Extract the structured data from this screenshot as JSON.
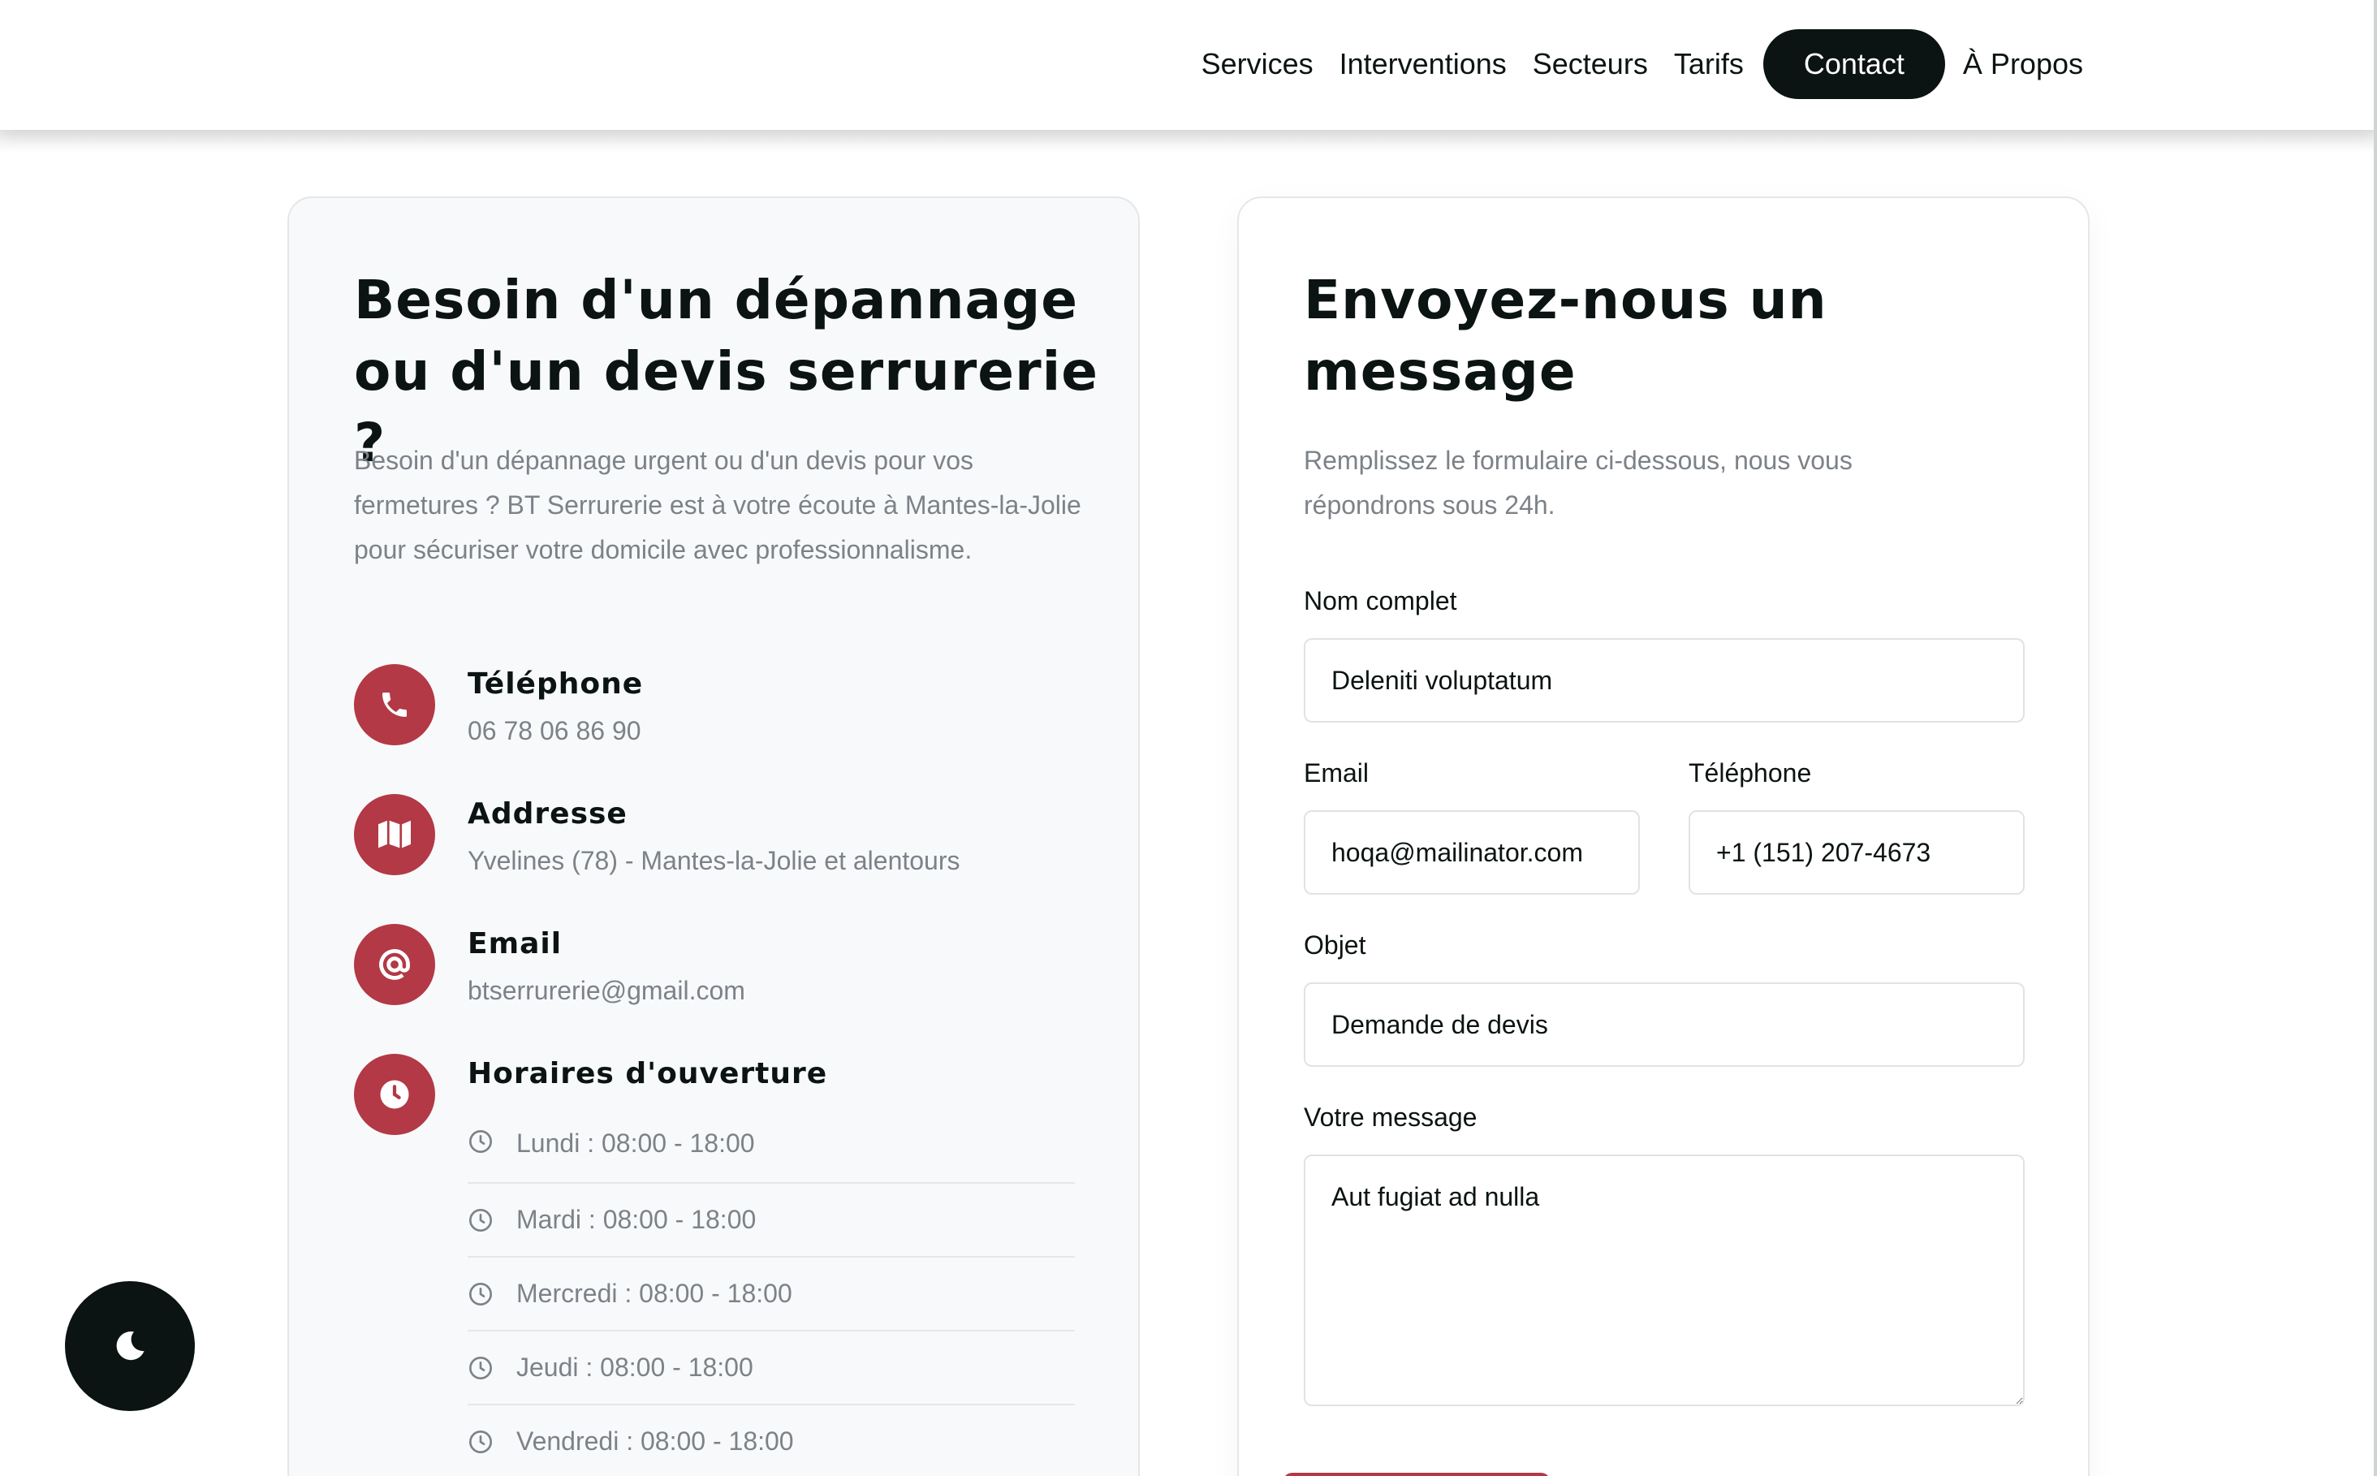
{
  "nav": {
    "items": [
      {
        "label": "Services"
      },
      {
        "label": "Interventions"
      },
      {
        "label": "Secteurs"
      },
      {
        "label": "Tarifs"
      },
      {
        "label": "Contact",
        "active": true
      },
      {
        "label": "À Propos"
      }
    ]
  },
  "contact_info": {
    "title": "Besoin d'un dépannage ou d'un devis serrurerie ?",
    "intro": "Besoin d'un dépannage urgent ou d'un devis pour vos fermetures ? BT Serrurerie est à votre écoute à Mantes-la-Jolie pour sécuriser votre domicile avec professionnalisme.",
    "phone": {
      "label": "Téléphone",
      "value": "06 78 06 86 90",
      "icon": "phone-icon"
    },
    "address": {
      "label": "Addresse",
      "value": "Yvelines (78) - Mantes-la-Jolie et alentours",
      "icon": "map-icon"
    },
    "email": {
      "label": "Email",
      "value": "btserrurerie@gmail.com",
      "icon": "at-sign-icon"
    },
    "hours": {
      "label": "Horaires d'ouverture",
      "icon": "clock-icon",
      "days": [
        "Lundi : 08:00 - 18:00",
        "Mardi : 08:00 - 18:00",
        "Mercredi : 08:00 - 18:00",
        "Jeudi : 08:00 - 18:00",
        "Vendredi : 08:00 - 18:00"
      ]
    }
  },
  "form": {
    "title": "Envoyez-nous un message",
    "intro": "Remplissez le formulaire ci-dessous, nous vous répondrons sous 24h.",
    "name": {
      "label": "Nom complet",
      "value": "Deleniti voluptatum"
    },
    "email": {
      "label": "Email",
      "value": "hoqa@mailinator.com"
    },
    "phone": {
      "label": "Téléphone",
      "value": "+1 (151) 207-4673"
    },
    "subject": {
      "label": "Objet",
      "value": "Demande de devis"
    },
    "message": {
      "label": "Votre message",
      "value": "Aut fugiat ad nulla"
    }
  },
  "theme_toggle": {
    "icon": "moon-icon"
  },
  "colors": {
    "accent": "#b23945",
    "dark": "#0b1412",
    "muted_text": "#7c8288",
    "card_bg": "#f8f9fa"
  }
}
